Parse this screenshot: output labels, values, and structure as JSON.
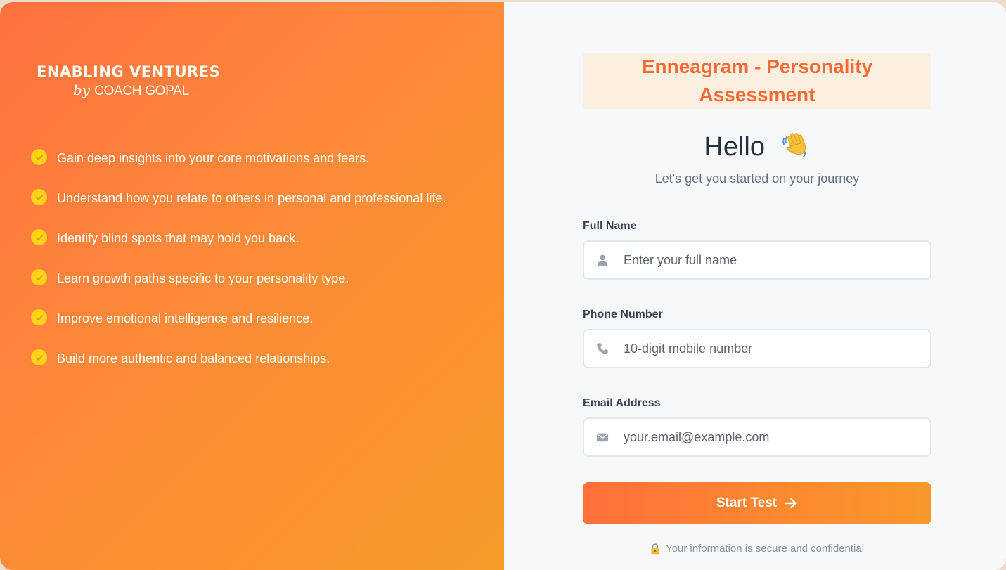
{
  "brand": {
    "name": "ENABLING VENTURES",
    "by": "by",
    "coach": "COACH GOPAL"
  },
  "benefits": [
    {
      "text": "Gain deep insights into your core motivations and fears."
    },
    {
      "text": "Understand how you relate to others in personal and professional life."
    },
    {
      "text": "Identify blind spots that may hold you back."
    },
    {
      "text": "Learn growth paths specific to your personality type."
    },
    {
      "text": "Improve emotional intelligence and resilience."
    },
    {
      "text": "Build more authentic and balanced relationships."
    }
  ],
  "form": {
    "headline": "Enneagram - Personality Assessment",
    "greeting": "Hello",
    "greeting_icon": "waving-hand-icon",
    "subtitle": "Let's get you started on your journey",
    "fields": [
      {
        "label": "Full Name",
        "placeholder": "Enter your full name",
        "value": "",
        "icon": "user-icon"
      },
      {
        "label": "Phone Number",
        "placeholder": "10-digit mobile number",
        "value": "",
        "icon": "phone-icon"
      },
      {
        "label": "Email Address",
        "placeholder": "your.email@example.com",
        "value": "",
        "icon": "envelope-icon"
      }
    ],
    "submit_label": "Start Test",
    "submit_icon": "arrow-right-icon",
    "secure_note": "Your information is secure and confidential",
    "secure_icon": "lock-icon"
  },
  "colors": {
    "accent": "#fb6a32",
    "gradient_start": "#ff7040",
    "gradient_end": "#f89a28",
    "check": "#ffd21a"
  }
}
